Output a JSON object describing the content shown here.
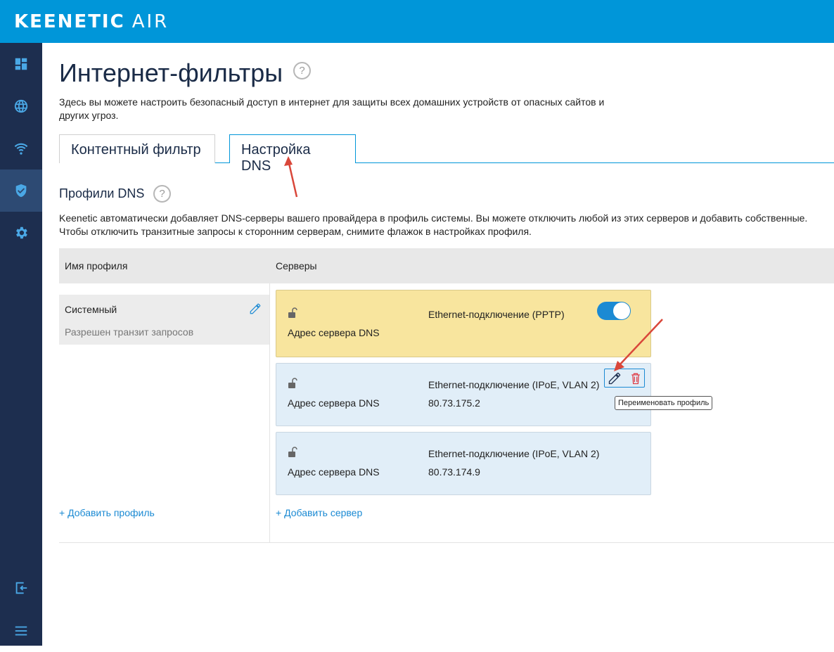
{
  "brand": {
    "name": "KEENETIC",
    "model": "AIR"
  },
  "sidebar": {
    "items": [
      {
        "icon": "dashboard-icon"
      },
      {
        "icon": "globe-icon"
      },
      {
        "icon": "wifi-icon"
      },
      {
        "icon": "shield-icon",
        "active": true
      },
      {
        "icon": "gear-icon"
      }
    ],
    "bottom": [
      {
        "icon": "logout-icon"
      },
      {
        "icon": "menu-icon"
      }
    ]
  },
  "page": {
    "title": "Интернет-фильтры",
    "help": "?",
    "description": "Здесь вы можете настроить безопасный доступ в интернет для защиты всех домашних устройств от опасных сайтов и других угроз."
  },
  "tabs": [
    {
      "label": "Контентный фильтр"
    },
    {
      "label": "Настройка DNS",
      "active": true
    }
  ],
  "dns_section": {
    "title": "Профили DNS",
    "help": "?",
    "description": "Keenetic автоматически добавляет DNS-серверы вашего провайдера в профиль системы. Вы можете отключить любой из этих серверов и добавить собственные. Чтобы отключить транзитные запросы к сторонним серверам, снимите флажок в настройках профиля."
  },
  "table": {
    "col_profile": "Имя профиля",
    "col_servers": "Серверы"
  },
  "profile": {
    "name": "Системный",
    "status": "Разрешен транзит запросов"
  },
  "servers": [
    {
      "label": "Адрес сервера DNS",
      "connection": "Ethernet-подключение (PPTP)",
      "ip": "",
      "enabled": true,
      "color": "#f8e59e"
    },
    {
      "label": "Адрес сервера DNS",
      "connection": "Ethernet-подключение (IPoE, VLAN 2)",
      "ip": "80.73.175.2",
      "color": "#e1eef8"
    },
    {
      "label": "Адрес сервера DNS",
      "connection": "Ethernet-подключение (IPoE, VLAN 2)",
      "ip": "80.73.174.9",
      "color": "#e1eef8"
    }
  ],
  "tooltip": "Переименовать профиль",
  "links": {
    "add_profile": "+ Добавить профиль",
    "add_server": "+ Добавить сервер"
  },
  "colors": {
    "topbar": "#0096d9",
    "sidebar": "#1d2e4f",
    "accent": "#1b8ad3",
    "annotation_arrow": "#d9473a"
  }
}
